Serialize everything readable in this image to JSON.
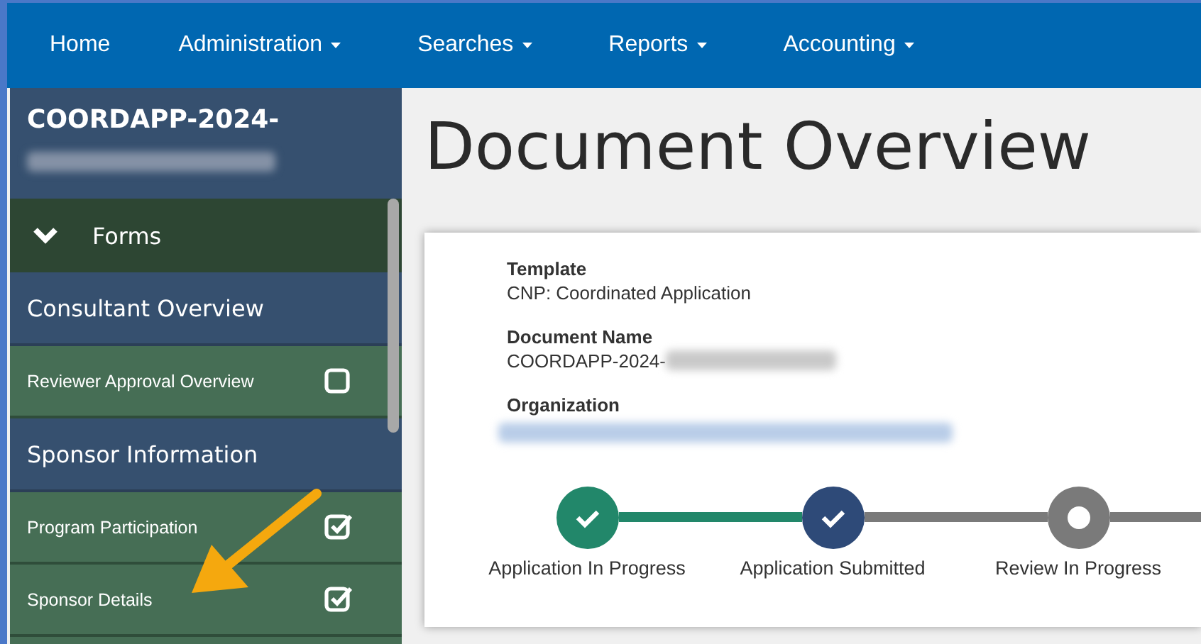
{
  "nav": [
    {
      "label": "Home",
      "dropdown": false
    },
    {
      "label": "Administration",
      "dropdown": true
    },
    {
      "label": "Searches",
      "dropdown": true
    },
    {
      "label": "Reports",
      "dropdown": true
    },
    {
      "label": "Accounting",
      "dropdown": true
    }
  ],
  "sidebar": {
    "title": "COORDAPP-2024-",
    "forms_header": {
      "label": "Forms",
      "expanded": true
    },
    "items": [
      {
        "kind": "section",
        "label": "Consultant Overview"
      },
      {
        "kind": "form",
        "label": "Reviewer Approval Overview",
        "checked": false
      },
      {
        "kind": "section",
        "label": "Sponsor Information"
      },
      {
        "kind": "form",
        "label": "Program Participation",
        "checked": true
      },
      {
        "kind": "form",
        "label": "Sponsor Details",
        "checked": true
      }
    ]
  },
  "page_title": "Document Overview",
  "fields": [
    {
      "label": "Template",
      "value": "CNP: Coordinated Application"
    },
    {
      "label": "Document Name",
      "value": "COORDAPP-2024-"
    },
    {
      "label": "Organization"
    }
  ],
  "steps": [
    {
      "label": "Application In Progress",
      "kind": "complete"
    },
    {
      "label": "Application Submitted",
      "kind": "submitted"
    },
    {
      "label": "Review In Progress",
      "kind": "current"
    }
  ]
}
